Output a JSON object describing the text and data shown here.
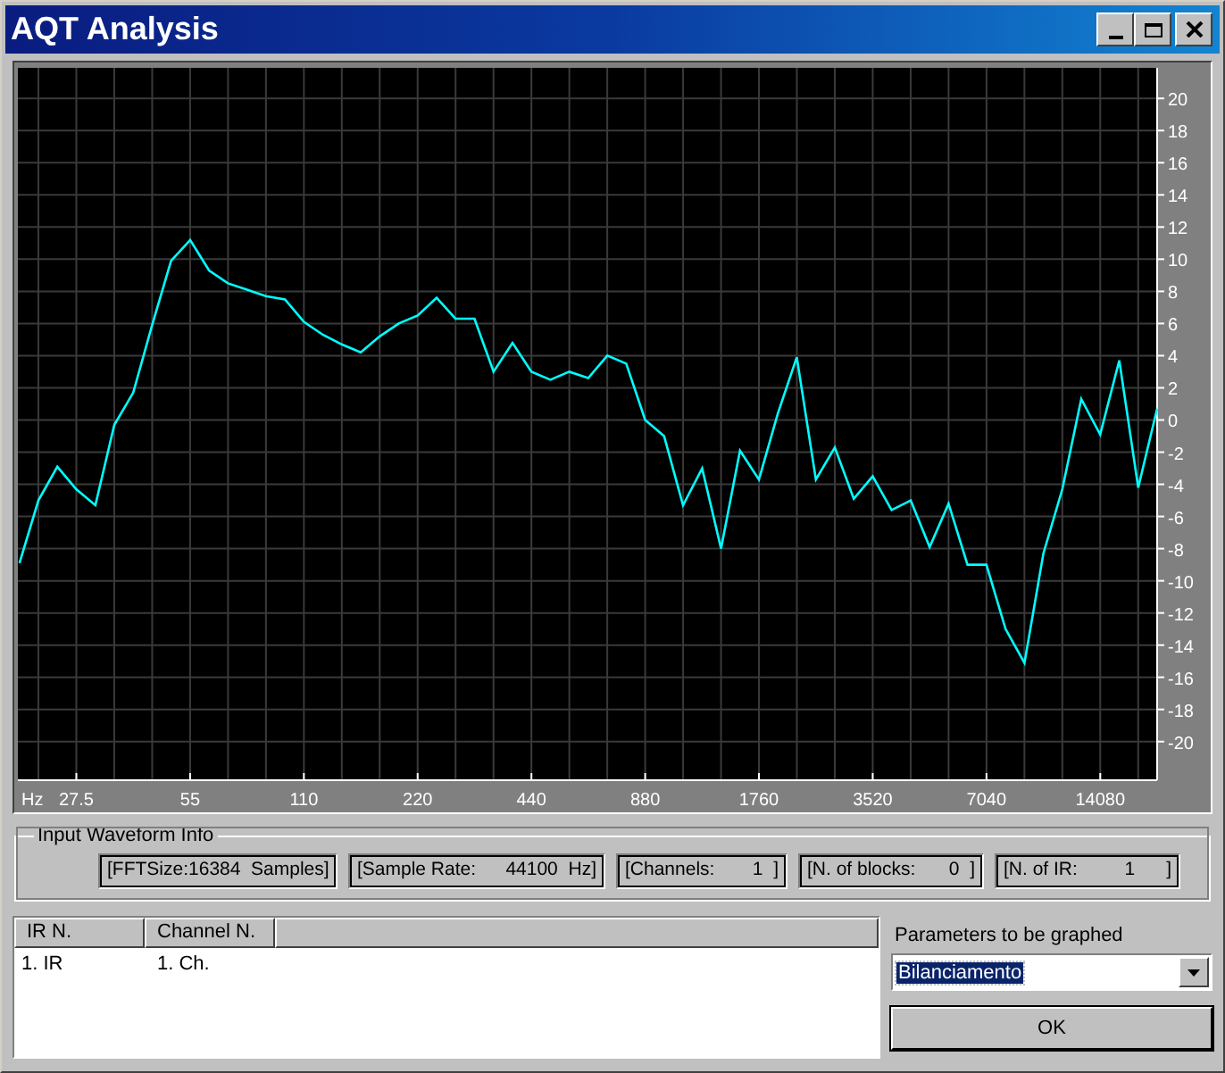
{
  "window": {
    "title": "AQT Analysis"
  },
  "plot": {
    "chart_data": {
      "type": "line",
      "grid": true,
      "xlabel": "Hz",
      "ylim": [
        -22.4,
        21.9
      ],
      "categories": [
        null,
        null,
        null,
        "27.5",
        null,
        null,
        null,
        null,
        null,
        "55",
        null,
        null,
        null,
        null,
        null,
        "110",
        null,
        null,
        null,
        null,
        null,
        "220",
        null,
        null,
        null,
        null,
        null,
        "440",
        null,
        null,
        null,
        null,
        null,
        "880",
        null,
        null,
        null,
        null,
        null,
        "1760",
        null,
        null,
        null,
        null,
        null,
        "3520",
        null,
        null,
        null,
        null,
        null,
        "7040",
        null,
        null,
        null,
        null,
        null,
        "14080",
        null,
        null,
        null
      ],
      "yticks": [
        20,
        18,
        16,
        14,
        12,
        10,
        8,
        6,
        4,
        2,
        0,
        -2,
        -4,
        -6,
        -8,
        -10,
        -12,
        -14,
        -16,
        -18,
        -20
      ],
      "series": [
        {
          "color": "#00ffff",
          "values": [
            -8.9,
            -5,
            -2.9,
            -4.3,
            -5.3,
            -0.3,
            1.7,
            5.9,
            9.9,
            11.2,
            9.3,
            8.5,
            8.1,
            7.7,
            7.5,
            6.1,
            5.3,
            4.7,
            4.2,
            5.2,
            6,
            6.5,
            7.6,
            6.3,
            6.3,
            3,
            4.8,
            3,
            2.5,
            3,
            2.6,
            4,
            3.5,
            0,
            -1,
            -5.3,
            -3,
            -8,
            -1.9,
            -3.7,
            0.4,
            3.9,
            -3.7,
            -1.7,
            -4.9,
            -3.5,
            -5.6,
            -5,
            -7.9,
            -5.2,
            -9,
            -9,
            -13,
            -15.1,
            -8.3,
            -4.3,
            1.3,
            -0.9,
            3.7,
            -4.2,
            0.7
          ]
        }
      ]
    }
  },
  "input_waveform_info": {
    "title": "Input Waveform Info",
    "fields": [
      {
        "label": "[FFTSize:",
        "value": "16384  Samples]"
      },
      {
        "label": "[Sample Rate:",
        "value": "44100  Hz]"
      },
      {
        "label": "[Channels:",
        "value": "1  ]"
      },
      {
        "label": "[N. of blocks:",
        "value": "0  ]"
      },
      {
        "label": "[N. of IR:",
        "value": "1      ]"
      }
    ]
  },
  "list": {
    "columns": [
      "IR N.",
      "Channel N."
    ],
    "rows": [
      {
        "cells": [
          "1. IR",
          "1. Ch."
        ]
      }
    ]
  },
  "parameters": {
    "label": "Parameters to be graphed",
    "value": "Bilanciamento",
    "text_selected": true
  },
  "buttons": [
    "OK"
  ]
}
